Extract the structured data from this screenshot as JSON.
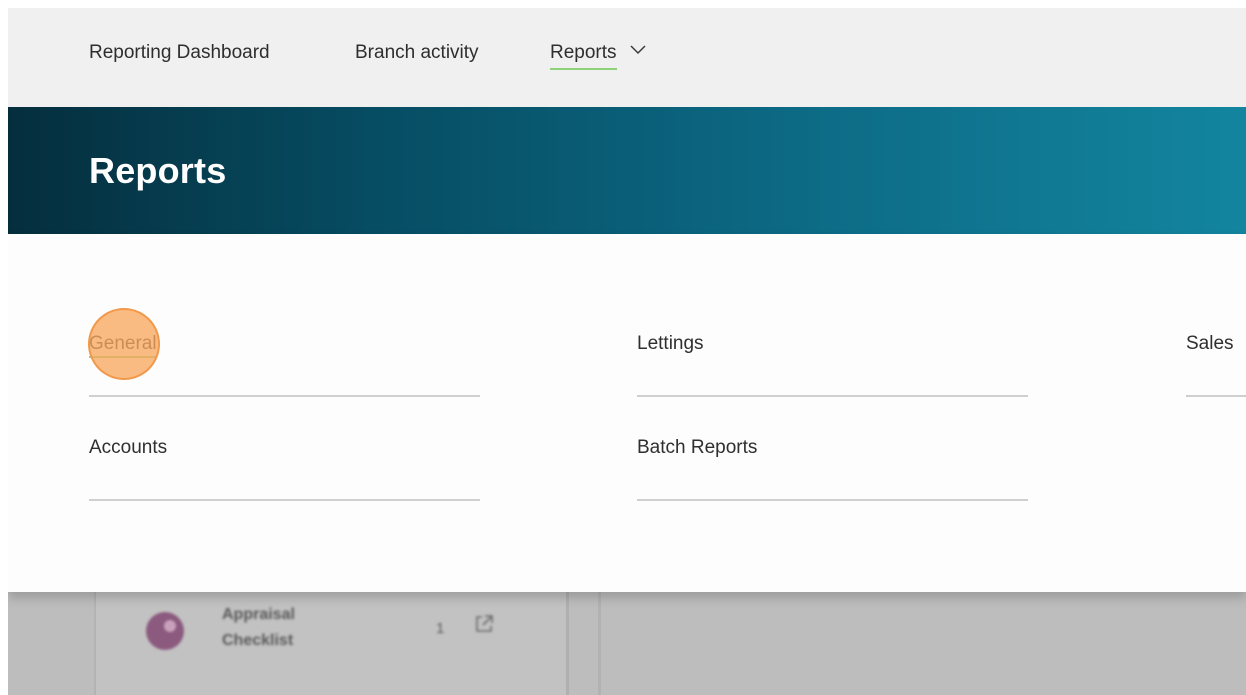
{
  "nav": {
    "items": [
      {
        "label": "Reporting Dashboard"
      },
      {
        "label": "Branch activity"
      },
      {
        "label": "Reports",
        "icon": "chevron-down-icon",
        "active": true
      }
    ]
  },
  "banner": {
    "title": "Reports"
  },
  "menu": {
    "links": [
      {
        "label": "General"
      },
      {
        "label": "Lettings"
      },
      {
        "label": "Sales"
      },
      {
        "label": "Accounts"
      },
      {
        "label": "Batch Reports"
      }
    ]
  },
  "background": {
    "item_title": "Appraisal Checklist",
    "item_count": "1",
    "icon": "external-link-icon"
  },
  "colors": {
    "accent_underline": "#8fd27a",
    "banner_start": "#052e3d",
    "banner_end": "#13859f",
    "click_marker": "#f9a85f"
  }
}
